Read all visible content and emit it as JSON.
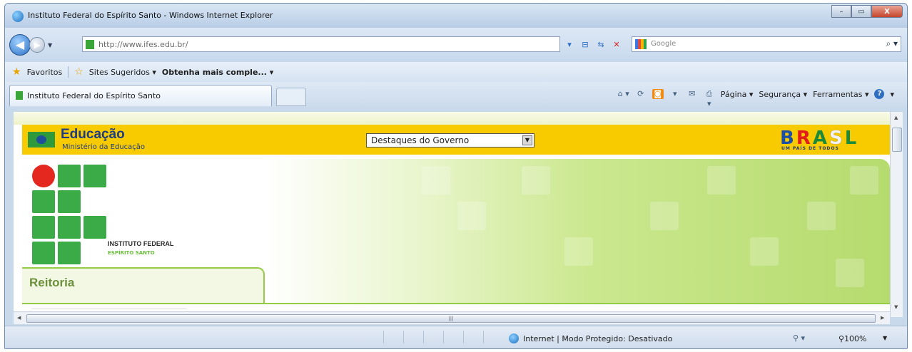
{
  "window": {
    "title": "Instituto Federal do Espírito Santo - Windows Internet Explorer",
    "minimize_glyph": "–",
    "maximize_glyph": "▭",
    "close_glyph": "X"
  },
  "nav": {
    "back_glyph": "◀",
    "forward_glyph": "▶",
    "history_glyph": "▼",
    "url": "http://www.ifes.edu.br/",
    "tools": [
      "▾",
      "⊟",
      "⇆",
      "✕"
    ],
    "search_placeholder": "Google",
    "search_glyph": "⌕ ▾"
  },
  "favorites": {
    "label": "Favoritos",
    "items": [
      {
        "label": "Sites Sugeridos ▾"
      },
      {
        "label": "Obtenha mais comple... ▾"
      }
    ]
  },
  "tabs": {
    "active_tab": "Instituto Federal do Espírito Santo",
    "commands": {
      "home_glyph": "⌂ ▾",
      "feeds_glyph": "⟳",
      "rss_glyph": "◙",
      "rss_arrow": "▾",
      "mail_glyph": "✉",
      "print_glyph": "⎙ ▾",
      "pagina": "Página ▾",
      "seguranca": "Segurança ▾",
      "ferramentas": "Ferramentas ▾",
      "help_glyph": "?",
      "help_arrow": "▾"
    }
  },
  "govbar": {
    "title": "Educação",
    "subtitle": "Ministério da Educação",
    "select_value": "Destaques do Governo",
    "select_arrow": "▼",
    "brasil": [
      "B",
      "R",
      "A",
      "S",
      "L"
    ],
    "brasil_tagline": "UM PAÍS DE TODOS"
  },
  "page": {
    "institute_name": "INSTITUTO FEDERAL",
    "institute_sub": "ESPÍRITO SANTO",
    "section_tab": "Reitoria"
  },
  "scroll": {
    "up": "▲",
    "down": "▼",
    "left": "◀",
    "right": "▶",
    "grip": "|||"
  },
  "status": {
    "zone_text": "Internet | Modo Protegido: Desativado",
    "zoom_icon": "⚲ ▾",
    "zoom": "⚲100%",
    "zoom_arrow": "▼"
  },
  "colors": {
    "gov_yellow": "#f8cb00",
    "if_green": "#3bab47",
    "if_red": "#e4281f"
  }
}
